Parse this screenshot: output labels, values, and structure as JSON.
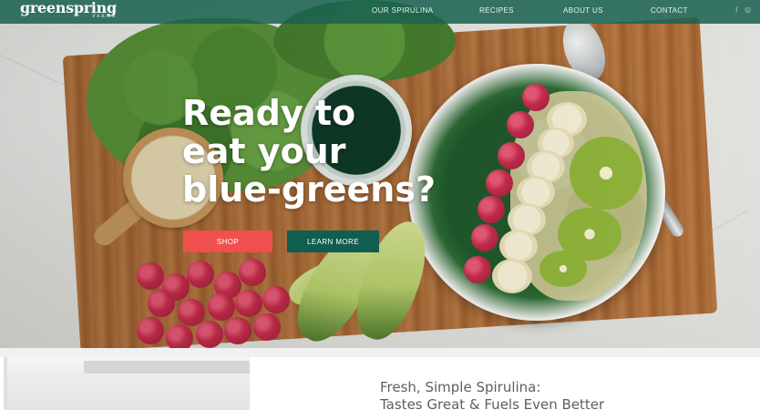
{
  "brand": {
    "name": "greenspring",
    "sub": "FARMS",
    "nav_color": "#196250",
    "shop_color": "#f0504d",
    "learn_color": "#0f5e50"
  },
  "nav": {
    "items": [
      {
        "label": "OUR SPIRULINA"
      },
      {
        "label": "RECIPES"
      },
      {
        "label": "ABOUT US"
      },
      {
        "label": "CONTACT"
      }
    ],
    "social": [
      {
        "icon": "facebook-icon",
        "glyph": "f"
      },
      {
        "icon": "instagram-icon",
        "glyph": "◎"
      }
    ]
  },
  "hero": {
    "headline_lines": [
      "Ready to",
      "eat your",
      "blue-greens?"
    ],
    "shop_label": "SHOP",
    "learn_label": "LEARN MORE"
  },
  "section": {
    "tagline_lines": [
      "Fresh, Simple Spirulina:",
      "Tastes Great & Fuels Even Better"
    ]
  }
}
